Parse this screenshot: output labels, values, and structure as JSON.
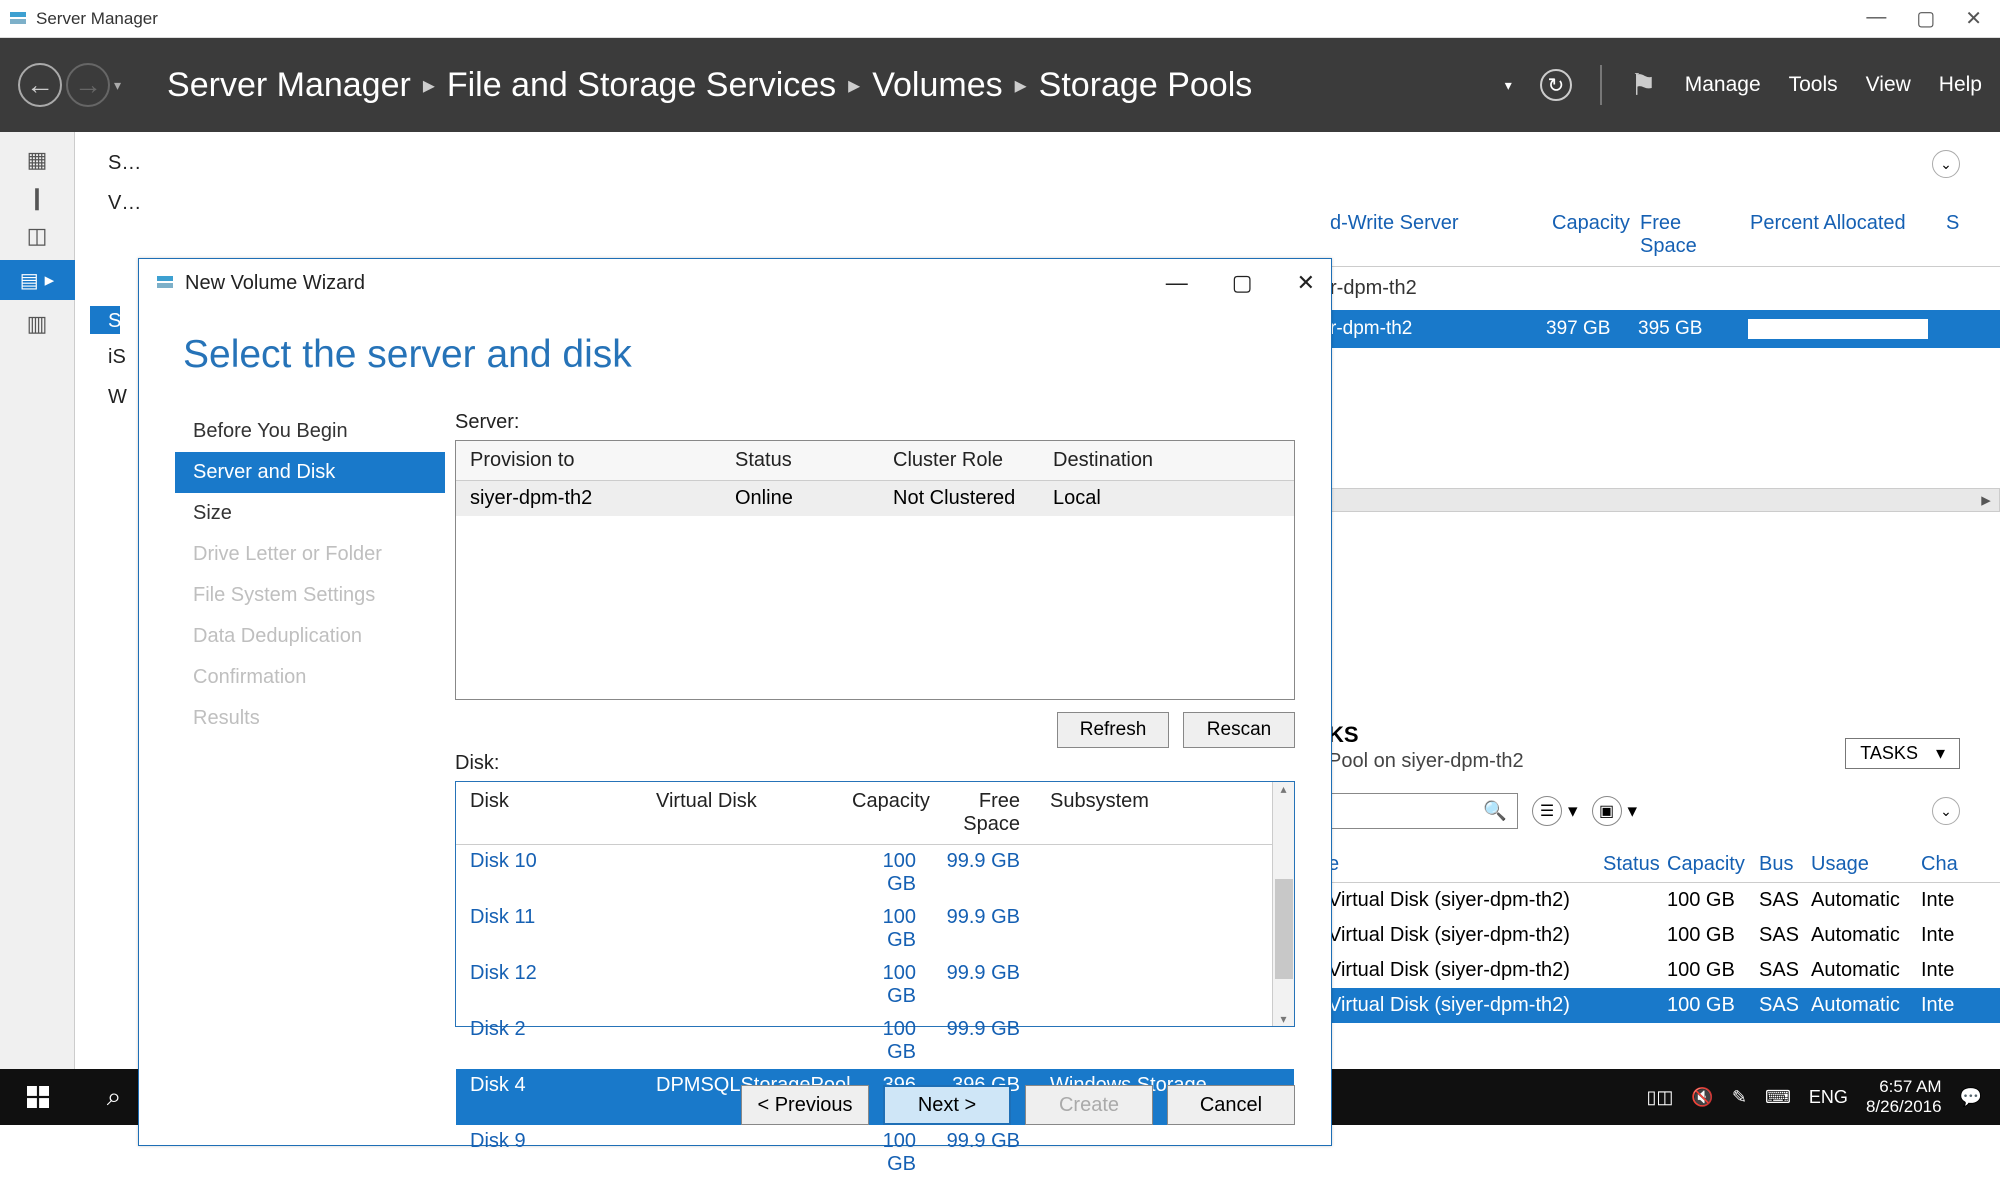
{
  "window": {
    "title": "Server Manager",
    "min": "—",
    "max": "▢",
    "close": "✕"
  },
  "nav": {
    "crumbs": [
      "Server Manager",
      "File and Storage Services",
      "Volumes",
      "Storage Pools"
    ],
    "menu": [
      "Manage",
      "Tools",
      "View",
      "Help"
    ]
  },
  "leftnav": {
    "items": [
      "S…",
      "V…",
      "",
      "S",
      "iS",
      "W"
    ]
  },
  "bgpool": {
    "columns": [
      "d-Write Server",
      "Capacity",
      "Free Space",
      "Percent Allocated",
      "S"
    ],
    "group": "r-dpm-th2",
    "row": {
      "name": "r-dpm-th2",
      "capacity": "397 GB",
      "free": "395 GB"
    }
  },
  "bgdisks": {
    "heading_suffix": "KS",
    "sub": "Pool on siyer-dpm-th2",
    "tasks_label": "TASKS",
    "columns": [
      "e",
      "Status",
      "Capacity",
      "Bus",
      "Usage",
      "Cha"
    ],
    "rows": [
      {
        "name": "Virtual Disk (siyer-dpm-th2)",
        "status": "",
        "cap": "100 GB",
        "bus": "SAS",
        "usage": "Automatic",
        "ext": "Inte",
        "sel": false
      },
      {
        "name": "Virtual Disk (siyer-dpm-th2)",
        "status": "",
        "cap": "100 GB",
        "bus": "SAS",
        "usage": "Automatic",
        "ext": "Inte",
        "sel": false
      },
      {
        "name": "Virtual Disk (siyer-dpm-th2)",
        "status": "",
        "cap": "100 GB",
        "bus": "SAS",
        "usage": "Automatic",
        "ext": "Inte",
        "sel": false
      },
      {
        "name": "Virtual Disk (siyer-dpm-th2)",
        "status": "",
        "cap": "100 GB",
        "bus": "SAS",
        "usage": "Automatic",
        "ext": "Inte",
        "sel": true
      }
    ]
  },
  "wizard": {
    "title": "New Volume Wizard",
    "heading": "Select the server and disk",
    "steps": [
      {
        "label": "Before You Begin",
        "state": "normal"
      },
      {
        "label": "Server and Disk",
        "state": "active"
      },
      {
        "label": "Size",
        "state": "normal"
      },
      {
        "label": "Drive Letter or Folder",
        "state": "disabled"
      },
      {
        "label": "File System Settings",
        "state": "disabled"
      },
      {
        "label": "Data Deduplication",
        "state": "disabled"
      },
      {
        "label": "Confirmation",
        "state": "disabled"
      },
      {
        "label": "Results",
        "state": "disabled"
      }
    ],
    "server_label": "Server:",
    "server_columns": [
      "Provision to",
      "Status",
      "Cluster Role",
      "Destination"
    ],
    "server_row": {
      "name": "siyer-dpm-th2",
      "status": "Online",
      "role": "Not Clustered",
      "dest": "Local"
    },
    "refresh": "Refresh",
    "rescan": "Rescan",
    "disk_label": "Disk:",
    "disk_columns": [
      "Disk",
      "Virtual Disk",
      "Capacity",
      "Free Space",
      "Subsystem"
    ],
    "disk_rows": [
      {
        "disk": "Disk 10",
        "vd": "",
        "cap": "100 GB",
        "free": "99.9 GB",
        "sub": "",
        "sel": false
      },
      {
        "disk": "Disk 11",
        "vd": "",
        "cap": "100 GB",
        "free": "99.9 GB",
        "sub": "",
        "sel": false
      },
      {
        "disk": "Disk 12",
        "vd": "",
        "cap": "100 GB",
        "free": "99.9 GB",
        "sub": "",
        "sel": false
      },
      {
        "disk": "Disk 2",
        "vd": "",
        "cap": "100 GB",
        "free": "99.9 GB",
        "sub": "",
        "sel": false
      },
      {
        "disk": "Disk 4",
        "vd": "DPMSQLStoragePool",
        "cap": "396 GB",
        "free": "396 GB",
        "sub": "Windows Storage",
        "sel": true
      },
      {
        "disk": "Disk 9",
        "vd": "",
        "cap": "100 GB",
        "free": "99.9 GB",
        "sub": "",
        "sel": false
      }
    ],
    "buttons": {
      "prev": "< Previous",
      "next": "Next >",
      "create": "Create",
      "cancel": "Cancel"
    }
  },
  "taskbar": {
    "lang": "ENG",
    "time": "6:57 AM",
    "date": "8/26/2016"
  }
}
